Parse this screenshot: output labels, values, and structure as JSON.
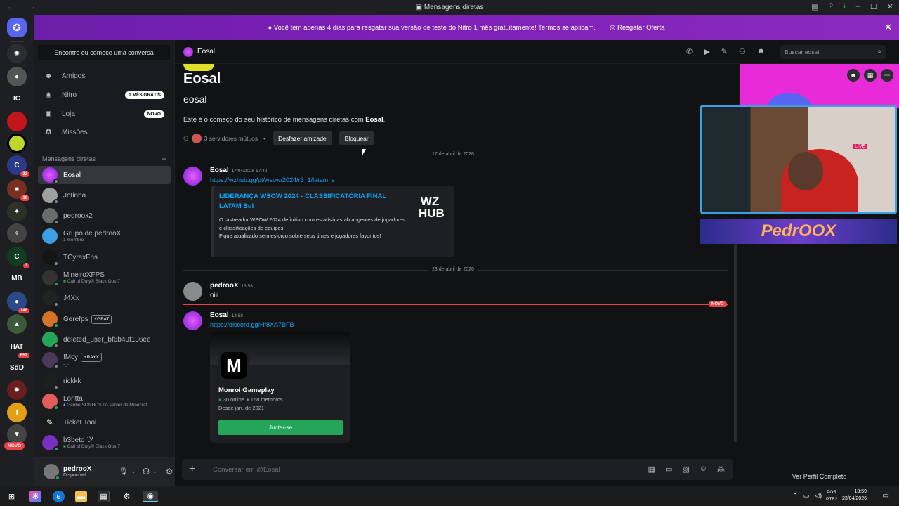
{
  "window": {
    "title": "Mensagens diretas"
  },
  "banner": {
    "text": "Você tem apenas 4 dias para resgatar sua versão de teste do Nitro 1 mês gratuitamente! Termos se aplicam.",
    "offer": "Resgatar Oferta"
  },
  "guilds": [
    "IC",
    "MB",
    "SdD",
    "HAT"
  ],
  "guild_badges": {
    "b1": "32",
    "b2": "18",
    "b3": "3",
    "b4": "146",
    "b5": "652",
    "novo": "NOVO"
  },
  "sidebar": {
    "search": "Encontre ou comece uma conversa",
    "nav": [
      {
        "label": "Amigos"
      },
      {
        "label": "Nitro",
        "pill": "1 MÊS GRÁTIS"
      },
      {
        "label": "Loja",
        "pill": "NOVO"
      },
      {
        "label": "Missões"
      }
    ],
    "dm_header": "Mensagens diretas",
    "dms": [
      {
        "name": "Eosal",
        "sub": ""
      },
      {
        "name": "Jotinha",
        "sub": ""
      },
      {
        "name": "pedroox2",
        "sub": ""
      },
      {
        "name": "Grupo de pedrooX",
        "sub": "1 membro"
      },
      {
        "name": "TCyraxFps",
        "sub": ""
      },
      {
        "name": "MineiroXFPS",
        "sub": "Call of Duty® Black Ops 7"
      },
      {
        "name": "J4Xx",
        "sub": ""
      },
      {
        "name": "Gerefps",
        "tag": "GBAT",
        "sub": ""
      },
      {
        "name": "deleted_user_bf6b40f136ee",
        "sub": ""
      },
      {
        "name": "!Mcy",
        "tag": "RAYX",
        "sub": "-_-"
      },
      {
        "name": "rickkk",
        "sub": ""
      },
      {
        "name": "Loritta",
        "sub": "Ganhe SONHOS no server de Minecraf..."
      },
      {
        "name": "Ticket Tool",
        "sub": ""
      },
      {
        "name": "b3beto ツ",
        "sub": "Call of Duty® Black Ops 7"
      }
    ]
  },
  "user": {
    "name": "pedrooX",
    "status": "Disponível"
  },
  "chat": {
    "header_name": "Eosal",
    "search_placeholder": "Buscar eosal",
    "title": "Eosal",
    "username": "eosal",
    "intro_prefix": "Este é o começo do seu histórico de mensagens diretas com ",
    "intro_name": "Eosal",
    "intro_suffix": ".",
    "mutual": "3 servidores mútuos",
    "unfriend": "Desfazer amizade",
    "block": "Bloquear",
    "date1": "17 de abril de 2026",
    "date2": "23 de abril de 2026",
    "messages": [
      {
        "author": "Eosal",
        "time": "17/04/2026 17:42",
        "link": "https://wzhub.gg/pt/wsow/2024/r3_1/latam_s"
      },
      {
        "author": "pedrooX",
        "time": "13:58",
        "text": "oiii"
      },
      {
        "author": "Eosal",
        "time": "13:58",
        "link": "https://discord.gg/Hf8XA7BFB"
      }
    ],
    "embed": {
      "title": "LIDERANÇA WSOW 2024 - CLASSIFICATÓRIA FINAL LATAM Sul",
      "description": "O rastreador WSOW 2024 definitivo com estatísticas abrangentes de jogadores e classificações de equipes.\nFique atualizado sem esforço sobre seus times e jogadores favoritos!",
      "logo": "WZ HUB"
    },
    "new_label": "NOVO",
    "invite": {
      "name": "Monroi Gameplay",
      "online": "30 online",
      "members": "168 membros",
      "since": "Desde jan. de 2021",
      "join": "Juntar-se"
    },
    "composer_placeholder": "Conversar em @Eosal"
  },
  "profile": {
    "view_full": "Ver Perfil Completo",
    "overlay_name": "PedrOOX",
    "live_label": "LIVE"
  },
  "taskbar": {
    "lang1": "POR",
    "lang2": "PTB2",
    "time": "13:59",
    "date": "23/04/2026"
  },
  "colors": {
    "accent": "#5865f2",
    "link": "#00a8fc",
    "online": "#23a55a",
    "danger": "#f23f43",
    "banner": "#7d1fb8"
  }
}
